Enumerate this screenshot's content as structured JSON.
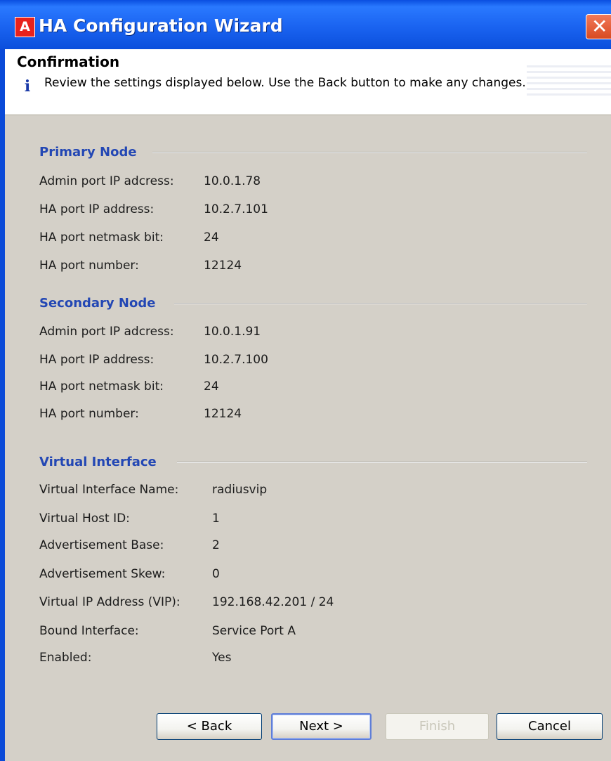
{
  "window": {
    "title": "HA Configuration Wizard",
    "app_icon_glyph": "A",
    "close_glyph": "✕"
  },
  "header": {
    "title": "Confirmation",
    "info_glyph": "i",
    "message": "Review the settings displayed below.  Use the Back button to make any changes."
  },
  "primary": {
    "title": "Primary Node",
    "rows": [
      {
        "label": "Admin port IP adcress:",
        "value": "10.0.1.78"
      },
      {
        "label": "HA port IP address:",
        "value": "10.2.7.101"
      },
      {
        "label": "HA port netmask bit:",
        "value": "24"
      },
      {
        "label": "HA port number:",
        "value": "12124"
      }
    ]
  },
  "secondary": {
    "title": "Secondary Node",
    "rows": [
      {
        "label": "Admin port IP adcress:",
        "value": "10.0.1.91"
      },
      {
        "label": "HA port IP address:",
        "value": "10.2.7.100"
      },
      {
        "label": "HA port netmask bit:",
        "value": "24"
      },
      {
        "label": "HA port number:",
        "value": "12124"
      }
    ]
  },
  "virtual": {
    "title": "Virtual Interface",
    "rows": [
      {
        "label": "Virtual Interface Name:",
        "value": "radiusvip"
      },
      {
        "label": "Virtual Host ID:",
        "value": "1"
      },
      {
        "label": "Advertisement Base:",
        "value": "2"
      },
      {
        "label": "Advertisement Skew:",
        "value": "0"
      },
      {
        "label": "Virtual IP Address (VIP):",
        "value": "192.168.42.201 / 24"
      },
      {
        "label": "Bound Interface:",
        "value": "Service Port A"
      },
      {
        "label": "Enabled:",
        "value": "Yes"
      }
    ]
  },
  "buttons": {
    "back": "< Back",
    "next": "Next >",
    "finish": "Finish",
    "cancel": "Cancel"
  },
  "colors": {
    "title_bar": "#0a4ad8",
    "dialog_bg": "#d4d0c8",
    "section_title": "#2347b4",
    "close_button": "#d84a21"
  },
  "icons": {
    "app": "app-logo-icon",
    "close": "close-icon",
    "info": "info-icon"
  }
}
